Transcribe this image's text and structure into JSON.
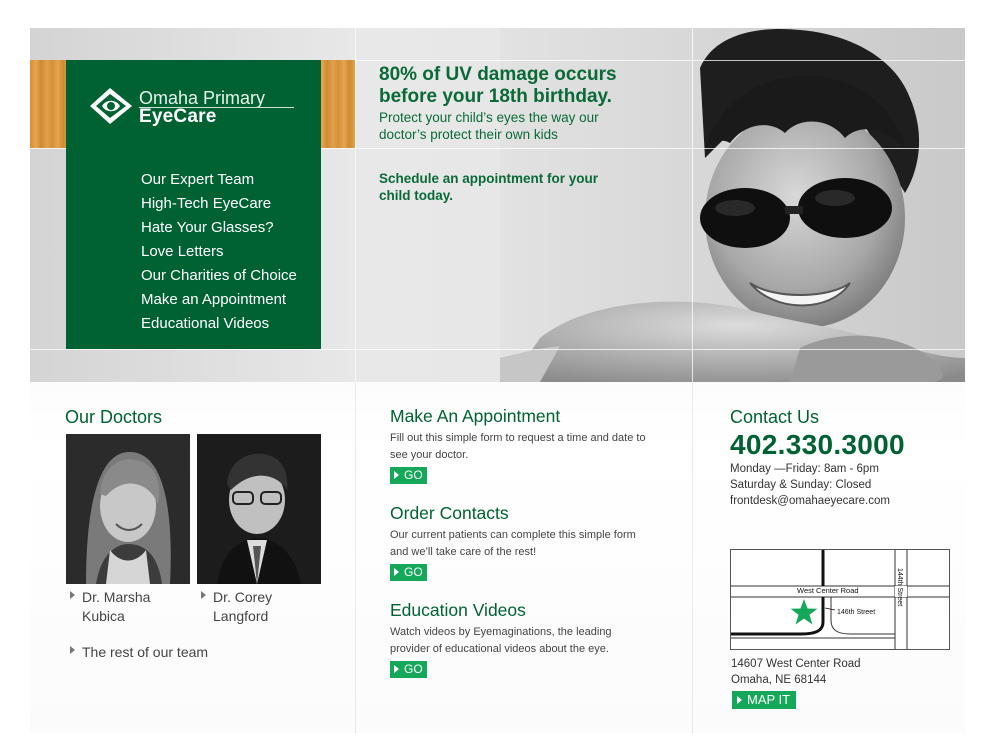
{
  "brand": {
    "name_line1": "Omaha Primary",
    "name_line2": "EyeCare",
    "colors": {
      "green": "#006233",
      "button_green": "#16a85a",
      "wood": "#d58e34"
    }
  },
  "nav": {
    "items": [
      {
        "label": "Our Expert Team"
      },
      {
        "label": "High-Tech EyeCare"
      },
      {
        "label": "Hate Your Glasses?"
      },
      {
        "label": "Love Letters"
      },
      {
        "label": "Our Charities of Choice"
      },
      {
        "label": "Make an Appointment"
      },
      {
        "label": "Educational Videos"
      }
    ]
  },
  "hero": {
    "headline": "80% of UV damage occurs before your 18th birthday.",
    "subline": "Protect your child’s eyes the way our doctor’s protect their own kids",
    "schedule": "Schedule an appointment for your child today."
  },
  "doctors": {
    "title": "Our Doctors",
    "list": [
      {
        "name_line1": "Dr. Marsha",
        "name_line2": "Kubica"
      },
      {
        "name_line1": "Dr. Corey",
        "name_line2": "Langford"
      }
    ],
    "rest_link": "The rest of our team"
  },
  "services": [
    {
      "title": "Make An Appointment",
      "text": "Fill out this simple form to request a time and date to see your doctor.",
      "button": "GO"
    },
    {
      "title": "Order Contacts",
      "text": "Our current patients can complete this simple form and we’ll take care of the rest!",
      "button": "GO"
    },
    {
      "title": "Education Videos",
      "text": "Watch videos by Eyemaginations, the leading provider of educational videos about the eye.",
      "button": "GO"
    }
  ],
  "contact": {
    "title": "Contact Us",
    "phone": "402.330.3000",
    "hours_weekday": "Monday  —Friday: 8am - 6pm",
    "hours_weekend": "Saturday & Sunday: Closed",
    "email": "frontdesk@omahaeyecare.com",
    "map": {
      "road1": "West Center Road",
      "road2": "146th Street",
      "road3": "144th Street"
    },
    "address_line1": "14607 West Center Road",
    "address_line2": "Omaha, NE 68144",
    "map_button": "MAP IT"
  }
}
